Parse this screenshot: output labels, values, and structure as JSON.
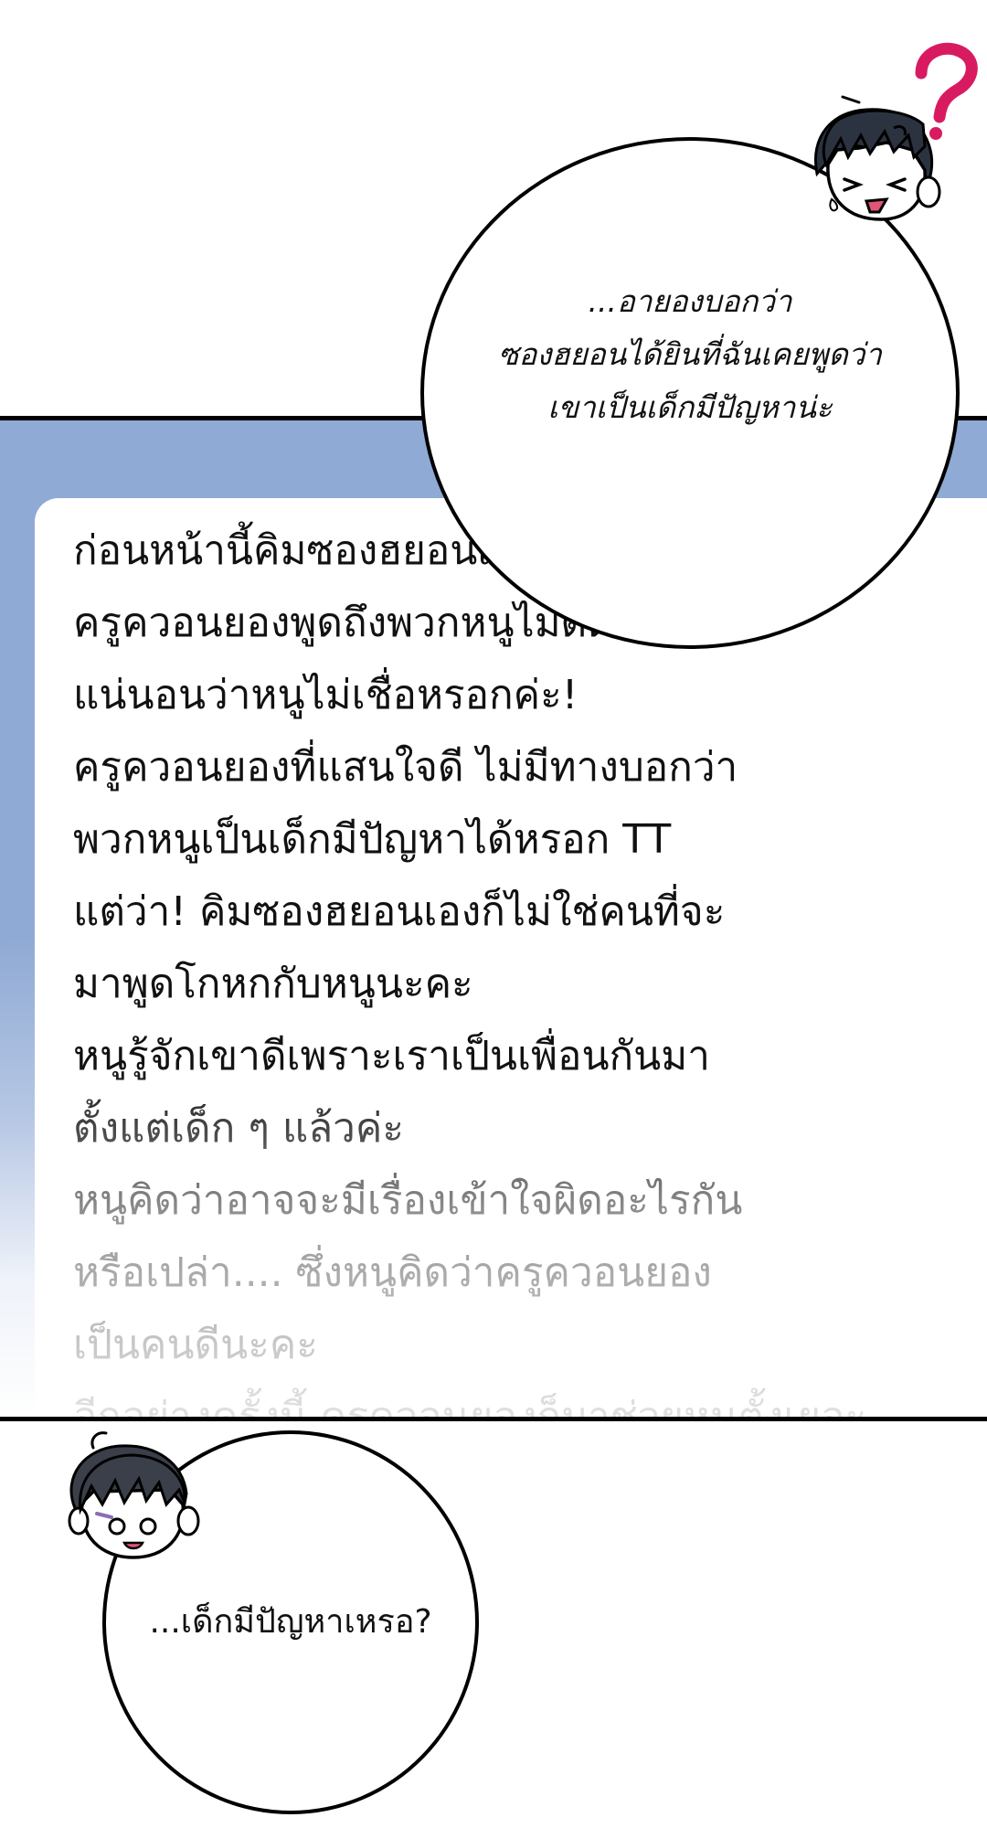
{
  "panels": {
    "top_balloon": {
      "lines": [
        "...อายองบอกว่า",
        "ซองฮยอนได้ยินที่ฉันเคยพูดว่า",
        "เขาเป็นเด็กมีปัญหาน่ะ"
      ]
    },
    "note": {
      "lines": [
        "ก่อนหน้านี้คิมซองฮยอนเคยบอกหนูว่า",
        "ครูควอนยองพูดถึงพวกหนูไม่ดีด้วยค่ะ",
        "แน่นอนว่าหนูไม่เชื่อหรอกค่ะ!",
        "ครูควอนยองที่แสนใจดี ไม่มีทางบอกว่า",
        "พวกหนูเป็นเด็กมีปัญหาได้หรอก TT",
        "แต่ว่า! คิมซองฮยอนเองก็ไม่ใช่คนที่จะ",
        "มาพูดโกหกกับหนูนะคะ",
        "หนูรู้จักเขาดีเพราะเราเป็นเพื่อนกันมา",
        "ตั้งแต่เด็ก ๆ แล้วค่ะ",
        "หนูคิดว่าอาจจะมีเรื่องเข้าใจผิดอะไรกัน",
        "หรือเปล่า.... ซึ่งหนูคิดว่าครูควอนยอง",
        "เป็นคนดีนะคะ",
        "อีกอย่างครั้งนี้ ครูควอนยองก็มาช่วยหนูตั้งเยอะ"
      ]
    },
    "bottom_balloon": {
      "lines": [
        "...เด็กมีปัญหาเหรอ?"
      ]
    }
  },
  "icons": {
    "top_character": "confused-boy-icon",
    "question_mark": "question-mark-icon",
    "bottom_character": "surprised-boy-icon"
  },
  "colors": {
    "panel_background": "#8faad4",
    "question_mark": "#d81b60",
    "ink": "#000000",
    "hair": "#2c3340"
  }
}
